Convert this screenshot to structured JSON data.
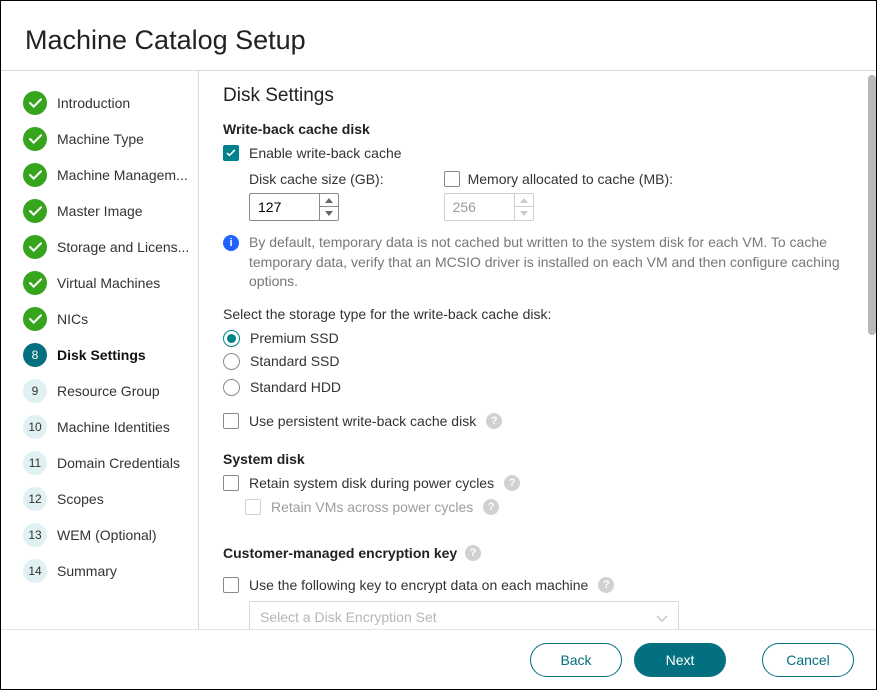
{
  "title": "Machine Catalog Setup",
  "steps": [
    {
      "label": "Introduction",
      "state": "done"
    },
    {
      "label": "Machine Type",
      "state": "done"
    },
    {
      "label": "Machine Managem...",
      "state": "done"
    },
    {
      "label": "Master Image",
      "state": "done"
    },
    {
      "label": "Storage and Licens...",
      "state": "done"
    },
    {
      "label": "Virtual Machines",
      "state": "done"
    },
    {
      "label": "NICs",
      "state": "done"
    },
    {
      "label": "Disk Settings",
      "state": "current",
      "num": "8"
    },
    {
      "label": "Resource Group",
      "state": "future",
      "num": "9"
    },
    {
      "label": "Machine Identities",
      "state": "future",
      "num": "10"
    },
    {
      "label": "Domain Credentials",
      "state": "future",
      "num": "11"
    },
    {
      "label": "Scopes",
      "state": "future",
      "num": "12"
    },
    {
      "label": "WEM (Optional)",
      "state": "future",
      "num": "13"
    },
    {
      "label": "Summary",
      "state": "future",
      "num": "14"
    }
  ],
  "page": {
    "heading": "Disk Settings",
    "wbcache": {
      "section_title": "Write-back cache disk",
      "enable_label": "Enable write-back cache",
      "disk_size_label": "Disk cache size (GB):",
      "disk_size_value": "127",
      "mem_label": "Memory allocated to cache (MB):",
      "mem_value": "256",
      "info_text": "By default, temporary data is not cached but written to the system disk for each VM. To cache temporary data, verify that an MCSIO driver is installed on each VM and then configure caching options.",
      "storage_prompt": "Select the storage type for the write-back cache disk:",
      "storage_options": [
        "Premium SSD",
        "Standard SSD",
        "Standard HDD"
      ],
      "persistent_label": "Use persistent write-back cache disk"
    },
    "sysdisk": {
      "section_title": "System disk",
      "retain_label": "Retain system disk during power cycles",
      "retain_vms_label": "Retain VMs across power cycles"
    },
    "cmek": {
      "section_title": "Customer-managed encryption key",
      "use_key_label": "Use the following key to encrypt data on each machine",
      "dropdown_placeholder": "Select a Disk Encryption Set"
    }
  },
  "footer": {
    "back": "Back",
    "next": "Next",
    "cancel": "Cancel"
  }
}
